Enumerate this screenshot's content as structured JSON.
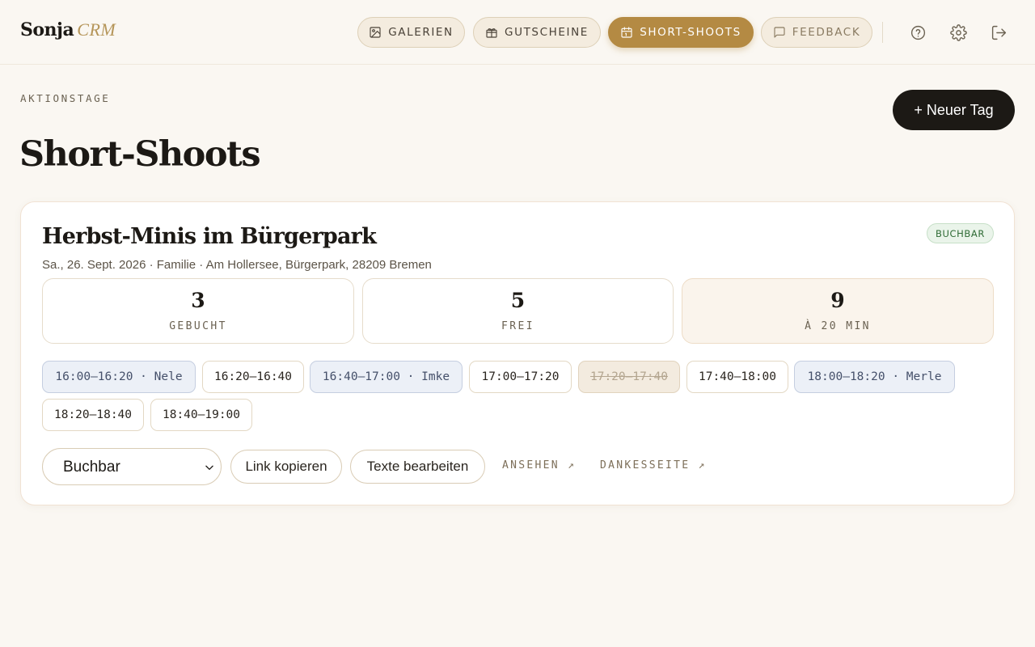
{
  "brand": {
    "name": "Sonja",
    "suffix": "CRM"
  },
  "nav": {
    "items": [
      {
        "label": "GALERIEN",
        "icon": "image-icon"
      },
      {
        "label": "GUTSCHEINE",
        "icon": "gift-icon"
      },
      {
        "label": "SHORT-SHOOTS",
        "icon": "calendar-icon",
        "active": true
      },
      {
        "label": "FEEDBACK",
        "icon": "message-icon"
      }
    ],
    "icons": [
      "help-icon",
      "settings-icon",
      "logout-icon"
    ]
  },
  "header": {
    "eyebrow": "AKTIONSTAGE",
    "title": "Short-Shoots",
    "new_button": "+ Neuer Tag"
  },
  "event": {
    "title": "Herbst-Minis im Bürgerpark",
    "meta": "Sa., 26. Sept. 2026 · Familie · Am Hollersee, Bürgerpark, 28209 Bremen",
    "status": "BUCHBAR",
    "stats": [
      {
        "value": "3",
        "label": "GEBUCHT"
      },
      {
        "value": "5",
        "label": "FREI"
      },
      {
        "value": "9",
        "label": "À 20 MIN"
      }
    ],
    "slots": [
      {
        "label": "16:00–16:20 · Nele",
        "state": "booked"
      },
      {
        "label": "16:20–16:40",
        "state": "free"
      },
      {
        "label": "16:40–17:00 · Imke",
        "state": "booked"
      },
      {
        "label": "17:00–17:20",
        "state": "free"
      },
      {
        "label": "17:20–17:40",
        "state": "blocked"
      },
      {
        "label": "17:40–18:00",
        "state": "free"
      },
      {
        "label": "18:00–18:20 · Merle",
        "state": "booked"
      },
      {
        "label": "18:20–18:40",
        "state": "free"
      },
      {
        "label": "18:40–19:00",
        "state": "free"
      }
    ],
    "status_select": {
      "value": "Buchbar"
    },
    "actions": {
      "copy_link": "Link kopieren",
      "edit_texts": "Texte bearbeiten",
      "view": "ANSEHEN ↗",
      "thanks_page": "DANKESSEITE ↗"
    }
  },
  "colors": {
    "background": "#faf7f2",
    "accent": "#b48a43",
    "dark": "#1c1915",
    "status_green": "#2f6b35",
    "booked_slot": "#ecf0f7"
  }
}
